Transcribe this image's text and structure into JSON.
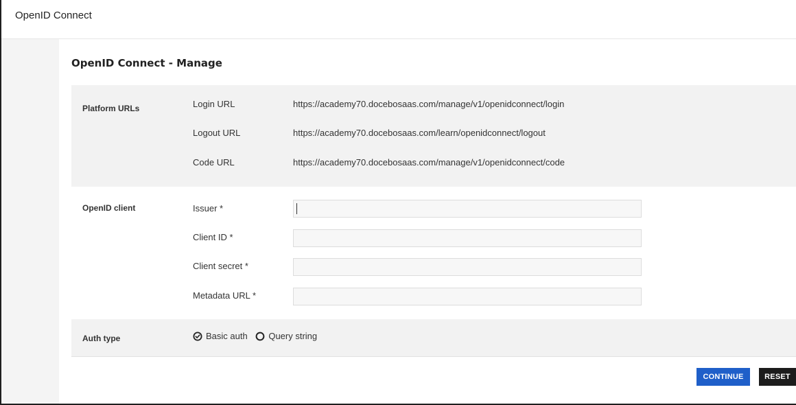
{
  "header": {
    "title": "OpenID Connect"
  },
  "page": {
    "title": "OpenID Connect - Manage"
  },
  "platform_urls": {
    "section_label": "Platform URLs",
    "rows": [
      {
        "label": "Login URL",
        "value": "https://academy70.docebosaas.com/manage/v1/openidconnect/login"
      },
      {
        "label": "Logout URL",
        "value": "https://academy70.docebosaas.com/learn/openidconnect/logout"
      },
      {
        "label": "Code URL",
        "value": "https://academy70.docebosaas.com/manage/v1/openidconnect/code"
      }
    ]
  },
  "openid_client": {
    "section_label": "OpenID client",
    "fields": [
      {
        "label": "Issuer *",
        "value": ""
      },
      {
        "label": "Client ID *",
        "value": ""
      },
      {
        "label": "Client secret *",
        "value": ""
      },
      {
        "label": "Metadata URL *",
        "value": ""
      }
    ]
  },
  "auth_type": {
    "section_label": "Auth type",
    "options": [
      {
        "label": "Basic auth",
        "selected": true
      },
      {
        "label": "Query string",
        "selected": false
      }
    ]
  },
  "actions": {
    "continue_label": "CONTINUE",
    "reset_label": "RESET"
  },
  "colors": {
    "primary_button": "#1f5fc9",
    "secondary_button": "#1c1c1c",
    "section_background": "#f2f2f2"
  }
}
